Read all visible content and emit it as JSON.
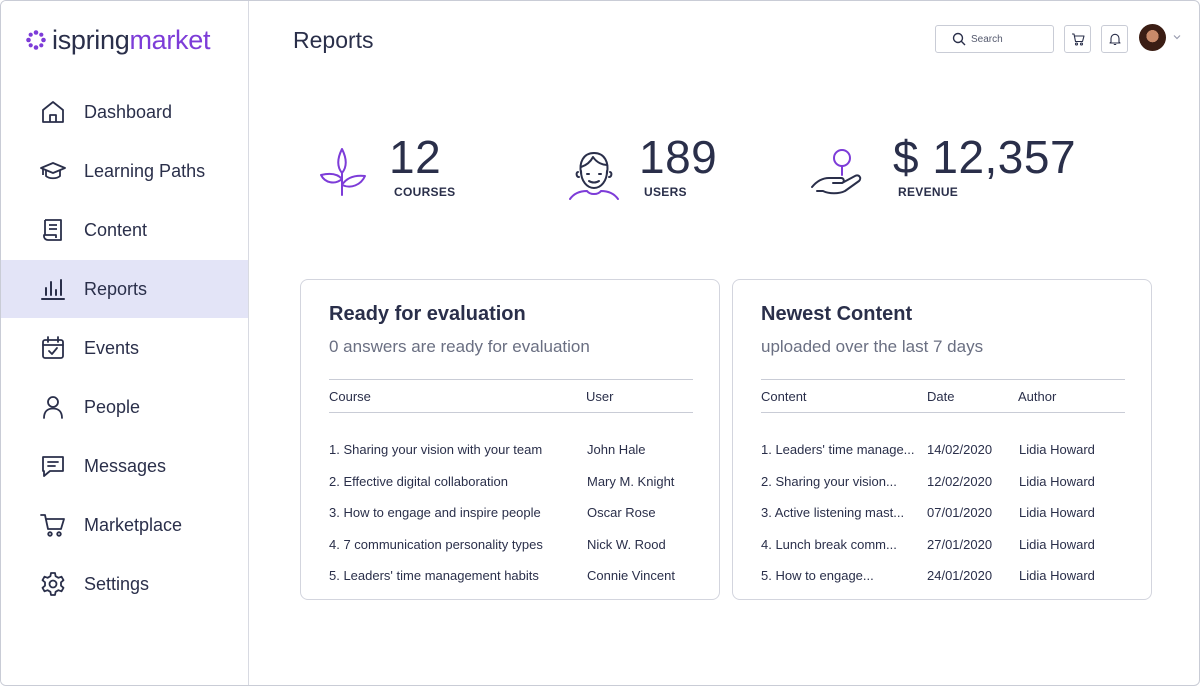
{
  "brand": {
    "name_part1": "ispring",
    "name_part2": "market",
    "accent": "#7d3cd8",
    "dark": "#2a2f4a"
  },
  "sidebar": {
    "items": [
      {
        "label": "Dashboard",
        "icon": "home-icon",
        "active": false
      },
      {
        "label": "Learning Paths",
        "icon": "graduation-cap-icon",
        "active": false
      },
      {
        "label": "Content",
        "icon": "scroll-icon",
        "active": false
      },
      {
        "label": "Reports",
        "icon": "bar-chart-icon",
        "active": true
      },
      {
        "label": "Events",
        "icon": "calendar-check-icon",
        "active": false
      },
      {
        "label": "People",
        "icon": "person-icon",
        "active": false
      },
      {
        "label": "Messages",
        "icon": "message-icon",
        "active": false
      },
      {
        "label": "Marketplace",
        "icon": "cart-icon",
        "active": false
      },
      {
        "label": "Settings",
        "icon": "gear-icon",
        "active": false
      }
    ]
  },
  "header": {
    "title": "Reports",
    "search_placeholder": "Search",
    "icons": [
      "search-icon",
      "cart-icon",
      "bell-icon",
      "avatar",
      "chevron-down-icon"
    ]
  },
  "stats": [
    {
      "value": "12",
      "caption": "COURSES",
      "icon": "sprout-icon"
    },
    {
      "value": "189",
      "caption": "USERS",
      "icon": "user-face-icon"
    },
    {
      "value": "$ 12,357",
      "caption": "REVENUE",
      "icon": "hand-coin-icon"
    }
  ],
  "evaluation": {
    "title": "Ready for evaluation",
    "subtitle": "0 answers are ready for evaluation",
    "columns": [
      "Course",
      "User"
    ],
    "rows": [
      {
        "course": "1. Sharing your vision with your team",
        "user": "John Hale"
      },
      {
        "course": "2. Effective digital collaboration",
        "user": "Mary M. Knight"
      },
      {
        "course": "3. How to engage and inspire people",
        "user": "Oscar Rose"
      },
      {
        "course": "4. 7 communication personality types",
        "user": "Nick W. Rood"
      },
      {
        "course": "5. Leaders' time management habits",
        "user": "Connie Vincent"
      }
    ]
  },
  "newest": {
    "title": "Newest Content",
    "subtitle": "uploaded over the last 7 days",
    "columns": [
      "Content",
      "Date",
      "Author"
    ],
    "rows": [
      {
        "content": "1. Leaders' time manage...",
        "date": "14/02/2020",
        "author": "Lidia Howard"
      },
      {
        "content": "2. Sharing your vision...",
        "date": "12/02/2020",
        "author": "Lidia Howard"
      },
      {
        "content": "3. Active listening mast...",
        "date": "07/01/2020",
        "author": "Lidia Howard"
      },
      {
        "content": "4. Lunch break comm...",
        "date": "27/01/2020",
        "author": "Lidia Howard"
      },
      {
        "content": "5. How to engage...",
        "date": "24/01/2020",
        "author": "Lidia Howard"
      }
    ]
  }
}
